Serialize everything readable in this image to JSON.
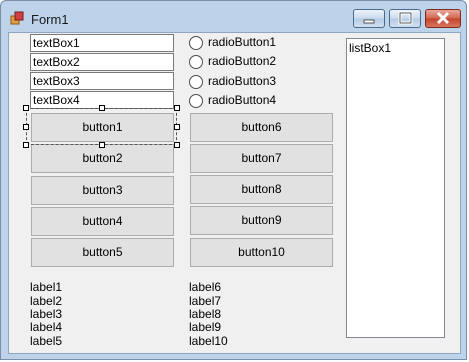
{
  "window": {
    "title": "Form1"
  },
  "textboxes": [
    "textBox1",
    "textBox2",
    "textBox3",
    "textBox4"
  ],
  "radios": [
    "radioButton1",
    "radioButton2",
    "radioButton3",
    "radioButton4"
  ],
  "buttons_left": [
    "button1",
    "button2",
    "button3",
    "button4",
    "button5"
  ],
  "buttons_right": [
    "button6",
    "button7",
    "button8",
    "button9",
    "button10"
  ],
  "listbox": {
    "items": [
      "listBox1"
    ]
  },
  "labels_left": [
    "label1",
    "label2",
    "label3",
    "label4",
    "label5"
  ],
  "labels_right": [
    "label6",
    "label7",
    "label8",
    "label9",
    "label10"
  ]
}
